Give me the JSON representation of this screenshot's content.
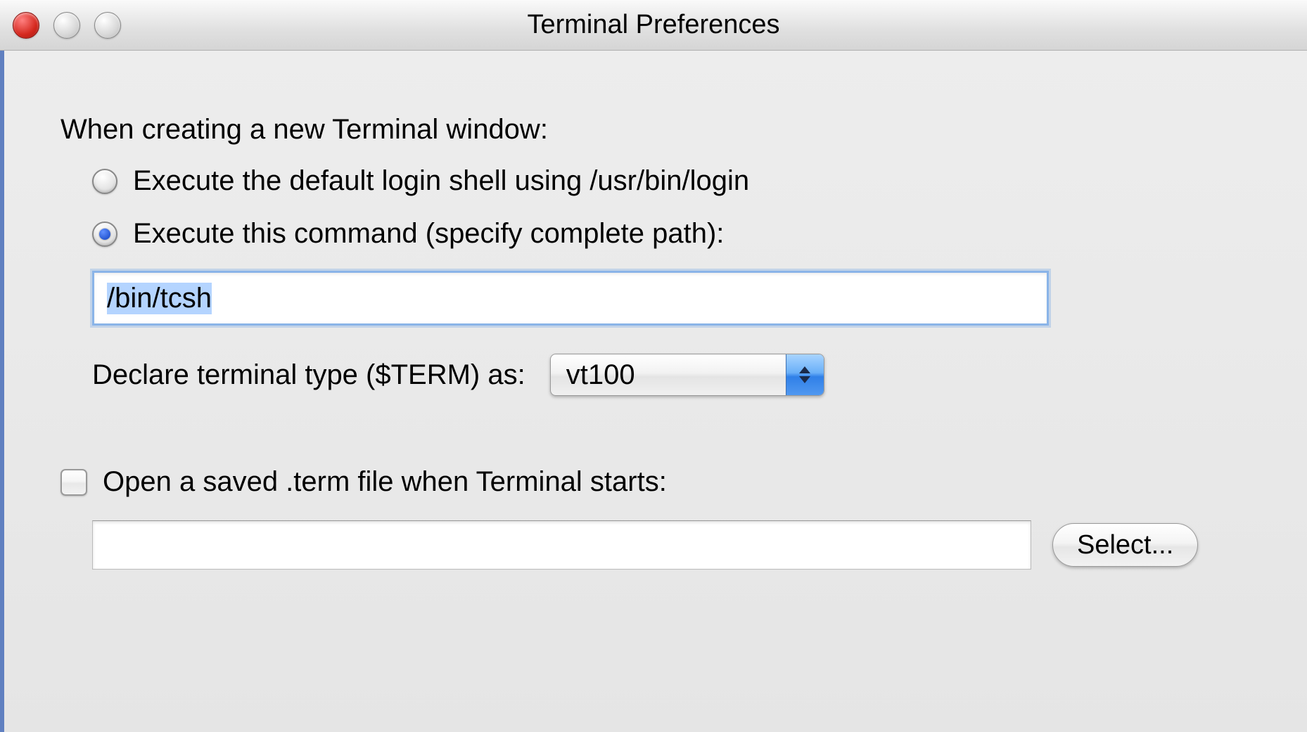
{
  "window": {
    "title": "Terminal Preferences"
  },
  "section1": {
    "heading": "When creating a new Terminal window:",
    "radio_default": "Execute the default login shell using /usr/bin/login",
    "radio_command": "Execute this command (specify complete path):",
    "command_value": "/bin/tcsh",
    "term_label": "Declare terminal type ($TERM) as:",
    "term_value": "vt100"
  },
  "section2": {
    "checkbox_label": "Open a saved .term file when Terminal starts:",
    "file_value": "",
    "select_button": "Select..."
  }
}
